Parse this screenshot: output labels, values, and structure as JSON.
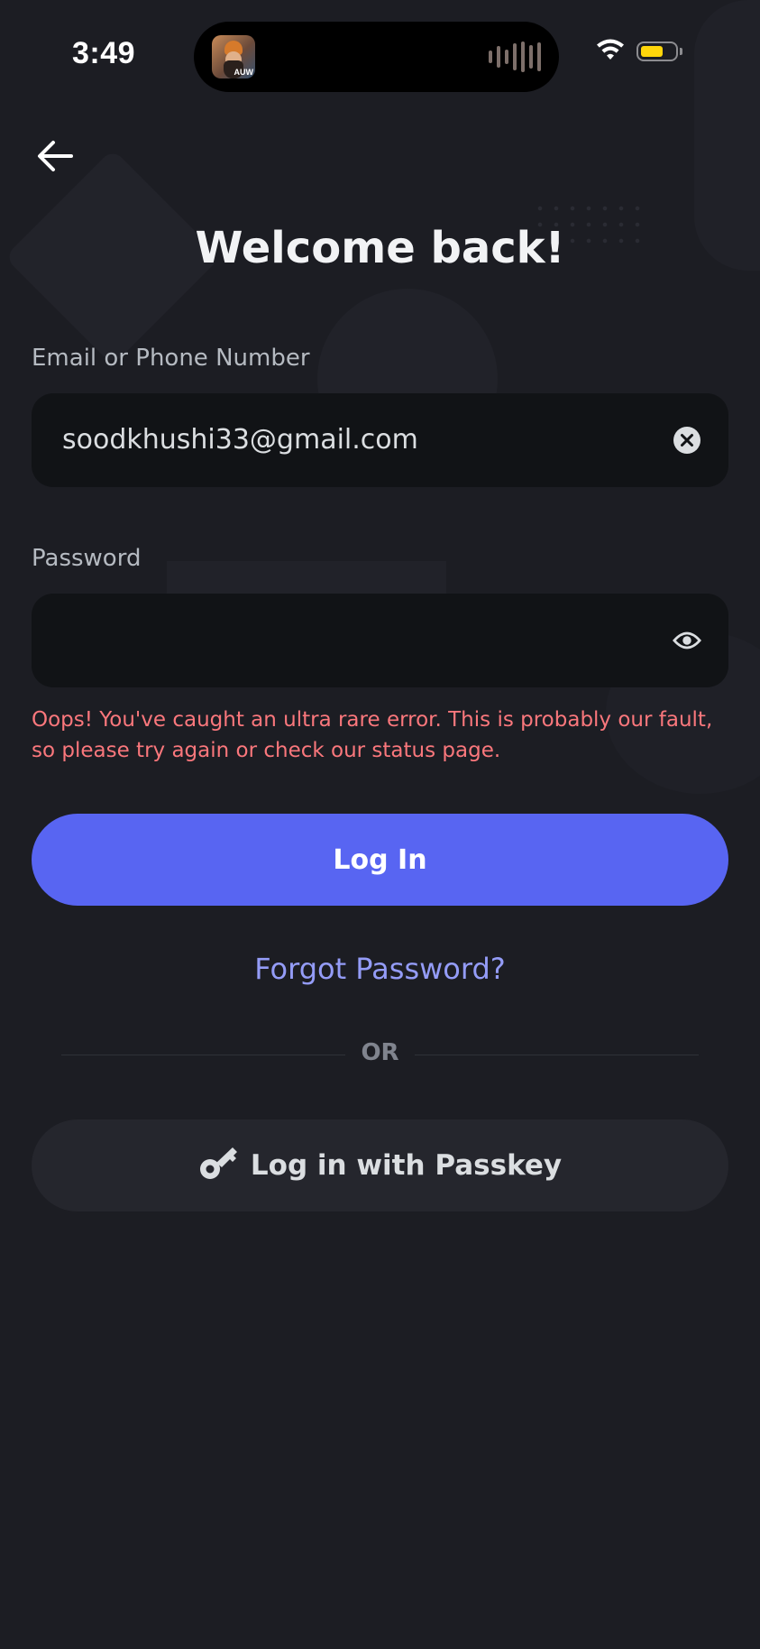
{
  "status_bar": {
    "time": "3:49",
    "island_avatar_tag": "AUW",
    "battery_color": "#ffd60a"
  },
  "header": {
    "back_icon": "arrow-left-icon",
    "title": "Welcome back!"
  },
  "email_field": {
    "label": "Email or Phone Number",
    "value": "soodkhushi33@gmail.com",
    "clear_icon": "clear-circle-x-icon"
  },
  "password_field": {
    "label": "Password",
    "value": "",
    "toggle_icon": "eye-icon"
  },
  "error": {
    "message": "Oops! You've caught an ultra rare error. This is probably our fault, so please try again or check our status page."
  },
  "actions": {
    "login_label": "Log In",
    "forgot_label": "Forgot Password?",
    "divider_label": "OR",
    "passkey_label": "Log in with Passkey",
    "passkey_icon": "key-icon"
  },
  "colors": {
    "background": "#1c1d23",
    "primary": "#5865f2",
    "link": "#949cf7",
    "error": "#fa777c",
    "input_bg": "#111316"
  }
}
